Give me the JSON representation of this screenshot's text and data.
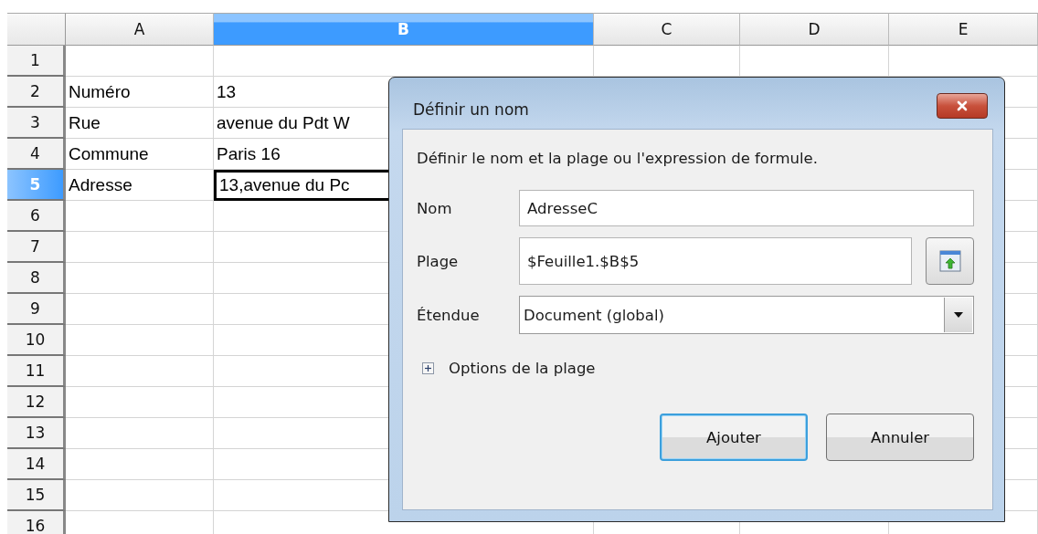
{
  "sheet": {
    "columns": [
      {
        "label": "A",
        "selected": false
      },
      {
        "label": "B",
        "selected": true
      },
      {
        "label": "C",
        "selected": false
      },
      {
        "label": "D",
        "selected": false
      },
      {
        "label": "E",
        "selected": false
      }
    ],
    "rows": [
      {
        "label": "1",
        "selected": false
      },
      {
        "label": "2",
        "selected": false,
        "cells": [
          {
            "text": "Numéro",
            "selected": false
          },
          {
            "text": "13",
            "selected": false
          }
        ]
      },
      {
        "label": "3",
        "selected": false,
        "cells": [
          {
            "text": "Rue",
            "selected": false
          },
          {
            "text": "avenue du Pdt W",
            "selected": false
          }
        ]
      },
      {
        "label": "4",
        "selected": false,
        "cells": [
          {
            "text": "Commune",
            "selected": false
          },
          {
            "text": "Paris 16",
            "selected": false
          }
        ]
      },
      {
        "label": "5",
        "selected": true,
        "cells": [
          {
            "text": "Adresse",
            "selected": false
          },
          {
            "text": "13,avenue du Pc",
            "selected": true
          }
        ]
      },
      {
        "label": "6",
        "selected": false
      },
      {
        "label": "7",
        "selected": false
      },
      {
        "label": "8",
        "selected": false
      },
      {
        "label": "9",
        "selected": false
      },
      {
        "label": "10",
        "selected": false
      },
      {
        "label": "11",
        "selected": false
      },
      {
        "label": "12",
        "selected": false
      },
      {
        "label": "13",
        "selected": false
      },
      {
        "label": "14",
        "selected": false
      },
      {
        "label": "15",
        "selected": false
      },
      {
        "label": "16",
        "selected": false
      }
    ]
  },
  "dialog": {
    "title": "Définir un nom",
    "description": "Définir le nom et la plage ou l'expression de formule.",
    "fields": [
      {
        "kind": "text",
        "label": "Nom",
        "value": "AdresseC"
      },
      {
        "kind": "range",
        "label": "Plage",
        "value": "$Feuille1.$B$5"
      },
      {
        "kind": "select",
        "label": "Étendue",
        "value": "Document (global)"
      }
    ],
    "options": {
      "label": "Options de la plage",
      "expanded": false
    },
    "buttons": [
      {
        "label": "Ajouter",
        "default": true
      },
      {
        "label": "Annuler",
        "default": false
      }
    ]
  }
}
